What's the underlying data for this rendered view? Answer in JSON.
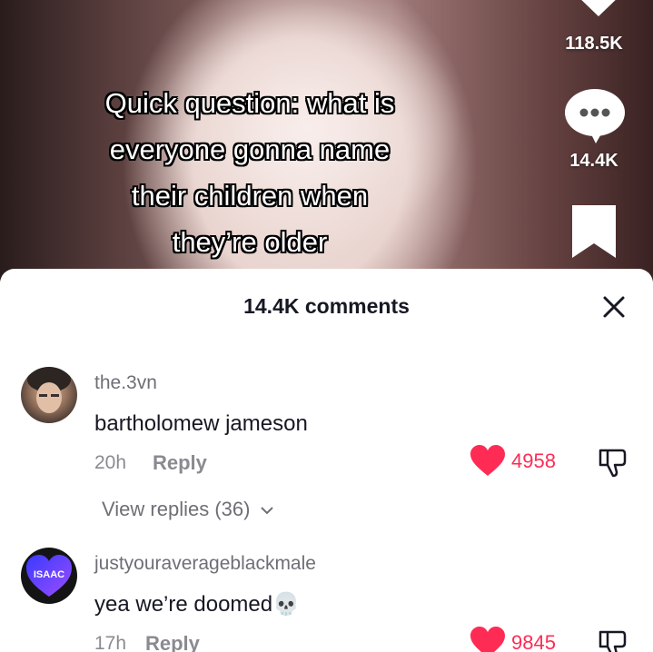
{
  "video": {
    "caption_lines": [
      "Quick question: what is",
      "everyone gonna name",
      "their children when",
      "they’re older"
    ],
    "likes_count": "118.5K",
    "comments_count": "14.4K"
  },
  "comments_sheet": {
    "title": "14.4K comments",
    "comments": [
      {
        "username": "the.3vn",
        "text": "bartholomew jameson",
        "time": "20h",
        "reply_label": "Reply",
        "likes": "4958",
        "view_replies": "View replies (36)"
      },
      {
        "username": "justyouraverageblackmale",
        "text": "yea we’re doomed",
        "emoji": "💀",
        "avatar_text": "ISAAC",
        "time": "17h",
        "reply_label": "Reply",
        "likes": "9845"
      }
    ]
  },
  "colors": {
    "like_red": "#fe2c55",
    "text_dark": "#161823",
    "muted": "#8a8b91"
  }
}
